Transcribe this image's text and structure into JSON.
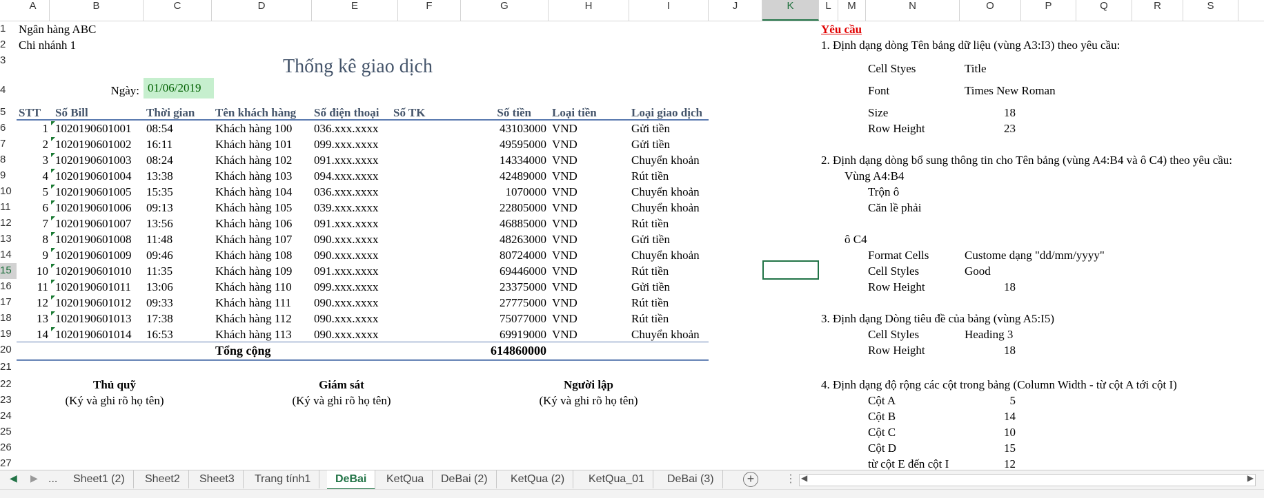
{
  "columns": [
    "A",
    "B",
    "C",
    "D",
    "E",
    "F",
    "G",
    "H",
    "I",
    "J",
    "K",
    "L",
    "M",
    "N",
    "O",
    "P",
    "Q",
    "R",
    "S"
  ],
  "selected_column": "K",
  "rows": [
    "1",
    "2",
    "3",
    "4",
    "5",
    "6",
    "7",
    "8",
    "9",
    "10",
    "11",
    "12",
    "13",
    "14",
    "15",
    "16",
    "17",
    "18",
    "19",
    "20",
    "21",
    "22",
    "23",
    "24",
    "25",
    "26",
    "27"
  ],
  "selected_row": "15",
  "bank": "Ngân hàng ABC",
  "branch": "Chi nhánh 1",
  "title": "Thống kê giao dịch",
  "date_label": "Ngày:",
  "date_value": "01/06/2019",
  "table_headers": [
    "STT",
    "Số Bill",
    "Thời gian",
    "Tên khách hàng",
    "Số điện thoại",
    "Số TK",
    "Số tiền",
    "Loại tiền",
    "Loại giao dịch"
  ],
  "records": [
    [
      "1",
      "1020190601001",
      "08:54",
      "Khách hàng 100",
      "036.xxx.xxxx",
      "",
      "43103000",
      "VND",
      "Gửi tiền"
    ],
    [
      "2",
      "1020190601002",
      "16:11",
      "Khách hàng 101",
      "099.xxx.xxxx",
      "",
      "49595000",
      "VND",
      "Gửi tiền"
    ],
    [
      "3",
      "1020190601003",
      "08:24",
      "Khách hàng 102",
      "091.xxx.xxxx",
      "",
      "14334000",
      "VND",
      "Chuyển khoản"
    ],
    [
      "4",
      "1020190601004",
      "13:38",
      "Khách hàng 103",
      "094.xxx.xxxx",
      "",
      "42489000",
      "VND",
      "Rút tiền"
    ],
    [
      "5",
      "1020190601005",
      "15:35",
      "Khách hàng 104",
      "036.xxx.xxxx",
      "",
      "1070000",
      "VND",
      "Chuyển khoản"
    ],
    [
      "6",
      "1020190601006",
      "09:13",
      "Khách hàng 105",
      "039.xxx.xxxx",
      "",
      "22805000",
      "VND",
      "Chuyển khoản"
    ],
    [
      "7",
      "1020190601007",
      "13:56",
      "Khách hàng 106",
      "091.xxx.xxxx",
      "",
      "46885000",
      "VND",
      "Rút tiền"
    ],
    [
      "8",
      "1020190601008",
      "11:48",
      "Khách hàng 107",
      "090.xxx.xxxx",
      "",
      "48263000",
      "VND",
      "Gửi tiền"
    ],
    [
      "9",
      "1020190601009",
      "09:46",
      "Khách hàng 108",
      "090.xxx.xxxx",
      "",
      "80724000",
      "VND",
      "Chuyển khoản"
    ],
    [
      "10",
      "1020190601010",
      "11:35",
      "Khách hàng 109",
      "091.xxx.xxxx",
      "",
      "69446000",
      "VND",
      "Rút tiền"
    ],
    [
      "11",
      "1020190601011",
      "13:06",
      "Khách hàng 110",
      "099.xxx.xxxx",
      "",
      "23375000",
      "VND",
      "Gửi tiền"
    ],
    [
      "12",
      "1020190601012",
      "09:33",
      "Khách hàng 111",
      "090.xxx.xxxx",
      "",
      "27775000",
      "VND",
      "Rút tiền"
    ],
    [
      "13",
      "1020190601013",
      "17:38",
      "Khách hàng 112",
      "090.xxx.xxxx",
      "",
      "75077000",
      "VND",
      "Rút tiền"
    ],
    [
      "14",
      "1020190601014",
      "16:53",
      "Khách hàng 113",
      "090.xxx.xxxx",
      "",
      "69919000",
      "VND",
      "Chuyển khoản"
    ]
  ],
  "total_label": "Tổng cộng",
  "total_value": "614860000",
  "signatures": [
    {
      "title": "Thủ quỹ",
      "note": "(Ký và ghi rõ họ tên)"
    },
    {
      "title": "Giám sát",
      "note": "(Ký và ghi rõ họ tên)"
    },
    {
      "title": "Người lập",
      "note": "(Ký và ghi rõ họ tên)"
    }
  ],
  "req_title": "Yêu cầu",
  "req1": "1. Định dạng dòng Tên bảng dữ liệu (vùng A3:I3) theo yêu cầu:",
  "req1_items": [
    [
      "Cell Styes",
      "Title"
    ],
    [
      "Font",
      "Times New Roman"
    ],
    [
      "Size",
      "18"
    ],
    [
      "Row Height",
      "23"
    ]
  ],
  "req2": "2. Định dạng dòng bổ sung thông tin cho Tên bảng (vùng A4:B4 và ô C4) theo yêu cầu:",
  "req2_range1": "Vùng A4:B4",
  "req2_range1_items": [
    "Trộn ô",
    "Căn lề phải"
  ],
  "req2_range2": "ô C4",
  "req2_range2_items": [
    [
      "Format Cells",
      "Custome dạng \"dd/mm/yyyy\""
    ],
    [
      "Cell Styles",
      "Good"
    ],
    [
      "Row Height",
      "18"
    ]
  ],
  "req3": "3. Định dạng Dòng tiêu đề của bảng (vùng A5:I5)",
  "req3_items": [
    [
      "Cell Styles",
      "Heading 3"
    ],
    [
      "Row Height",
      "18"
    ]
  ],
  "req4": "4. Định dạng độ rộng các cột trong bảng (Column Width - từ cột A tới cột I)",
  "req4_items": [
    [
      "Cột A",
      "5"
    ],
    [
      "Cột B",
      "14"
    ],
    [
      "Cột C",
      "10"
    ],
    [
      "Cột D",
      "15"
    ],
    [
      "từ cột E đến cột I",
      "12"
    ]
  ],
  "sheet_tabs": [
    "...",
    "Sheet1 (2)",
    "Sheet2",
    "Sheet3",
    "Trang tính1",
    "DeBai",
    "KetQua",
    "DeBai (2)",
    "KetQua (2)",
    "KetQua_01",
    "DeBai (3)"
  ],
  "active_tab": "DeBai",
  "colors": {
    "title": "#44546a",
    "header": "#44546a",
    "good_bg": "#c6efce",
    "good_text": "#006100",
    "req_title": "#e00000",
    "selection": "#217346"
  }
}
